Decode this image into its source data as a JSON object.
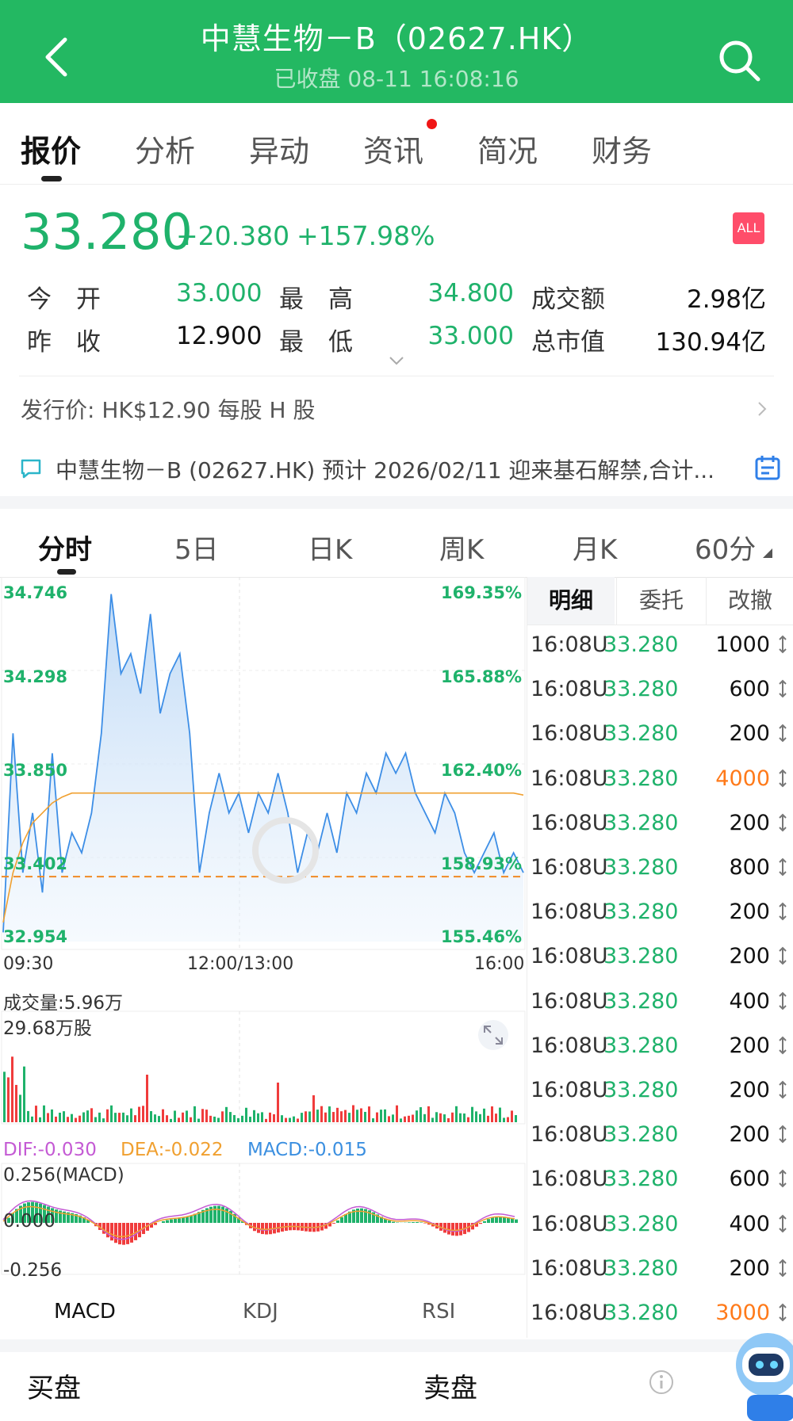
{
  "header": {
    "title": "中慧生物－B（02627.HK）",
    "status": "已收盘 08-11 16:08:16"
  },
  "tabs": [
    {
      "label": "报价",
      "active": true
    },
    {
      "label": "分析"
    },
    {
      "label": "异动"
    },
    {
      "label": "资讯",
      "badge": true
    },
    {
      "label": "简况"
    },
    {
      "label": "财务"
    }
  ],
  "quote": {
    "price": "33.280",
    "change": "+20.380",
    "change_pct": "+157.98%",
    "market_badge": "ALL",
    "open_label": "今　开",
    "open": "33.000",
    "high_label": "最　高",
    "high": "34.800",
    "turnover_label": "成交额",
    "turnover": "2.98亿",
    "prev_close_label": "昨　收",
    "prev_close": "12.900",
    "low_label": "最　低",
    "low": "33.000",
    "mktcap_label": "总市值",
    "mktcap": "130.94亿"
  },
  "issue_price": "发行价: HK$12.90 每股 H 股",
  "news_ticker": "中慧生物－B (02627.HK) 预计 2026/02/11 迎来基石解禁,合计...",
  "chart_tabs": [
    {
      "label": "分时",
      "active": true
    },
    {
      "label": "5日"
    },
    {
      "label": "日K"
    },
    {
      "label": "周K"
    },
    {
      "label": "月K"
    },
    {
      "label": "60分"
    }
  ],
  "chart_data": {
    "type": "line",
    "price_axis": [
      "34.746",
      "34.298",
      "33.850",
      "33.402",
      "32.954"
    ],
    "pct_axis": [
      "169.35%",
      "165.88%",
      "162.40%",
      "158.93%",
      "155.46%"
    ],
    "time_axis": [
      "09:30",
      "12:00/13:00",
      "16:00"
    ],
    "ylim": [
      32.954,
      34.746
    ],
    "ref_level": 33.28,
    "price": [
      33.0,
      34.0,
      33.3,
      33.6,
      33.2,
      33.9,
      33.3,
      33.5,
      33.4,
      33.6,
      34.0,
      34.7,
      34.3,
      34.4,
      34.2,
      34.6,
      34.1,
      34.3,
      34.4,
      34.0,
      33.3,
      33.6,
      33.8,
      33.6,
      33.7,
      33.5,
      33.7,
      33.6,
      33.8,
      33.6,
      33.3,
      33.5,
      33.4,
      33.6,
      33.4,
      33.7,
      33.6,
      33.8,
      33.7,
      33.9,
      33.8,
      33.9,
      33.7,
      33.6,
      33.5,
      33.7,
      33.6,
      33.4,
      33.3,
      33.4,
      33.5,
      33.3,
      33.4,
      33.3
    ],
    "avg": [
      33.05,
      33.3,
      33.45,
      33.55,
      33.6,
      33.65,
      33.68,
      33.7,
      33.7,
      33.7,
      33.7,
      33.7,
      33.7,
      33.7,
      33.7,
      33.7,
      33.7,
      33.7,
      33.7,
      33.7,
      33.7,
      33.7,
      33.7,
      33.7,
      33.7,
      33.7,
      33.7,
      33.7,
      33.7,
      33.7,
      33.7,
      33.7,
      33.7,
      33.7,
      33.7,
      33.7,
      33.7,
      33.7,
      33.7,
      33.7,
      33.7,
      33.7,
      33.7,
      33.7,
      33.7,
      33.7,
      33.7,
      33.7,
      33.7,
      33.7,
      33.7,
      33.7,
      33.7,
      33.69
    ],
    "volume_label": "成交量:5.96万",
    "volume_max_label": "29.68万股",
    "macd_dif": "DIF:-0.030",
    "macd_dea": "DEA:-0.022",
    "macd_val": "MACD:-0.015",
    "macd_top": "0.256(MACD)",
    "macd_zero": "0.000",
    "macd_bottom": "-0.256"
  },
  "detail_tabs": [
    {
      "label": "明细",
      "active": true
    },
    {
      "label": "委托"
    },
    {
      "label": "改撤"
    }
  ],
  "trades": [
    {
      "time": "16:08U",
      "price": "33.280",
      "vol": "1000"
    },
    {
      "time": "16:08U",
      "price": "33.280",
      "vol": "600"
    },
    {
      "time": "16:08U",
      "price": "33.280",
      "vol": "200"
    },
    {
      "time": "16:08U",
      "price": "33.280",
      "vol": "4000",
      "highlight": true
    },
    {
      "time": "16:08U",
      "price": "33.280",
      "vol": "200"
    },
    {
      "time": "16:08U",
      "price": "33.280",
      "vol": "800"
    },
    {
      "time": "16:08U",
      "price": "33.280",
      "vol": "200"
    },
    {
      "time": "16:08U",
      "price": "33.280",
      "vol": "200"
    },
    {
      "time": "16:08U",
      "price": "33.280",
      "vol": "400"
    },
    {
      "time": "16:08U",
      "price": "33.280",
      "vol": "200"
    },
    {
      "time": "16:08U",
      "price": "33.280",
      "vol": "200"
    },
    {
      "time": "16:08U",
      "price": "33.280",
      "vol": "200"
    },
    {
      "time": "16:08U",
      "price": "33.280",
      "vol": "600"
    },
    {
      "time": "16:08U",
      "price": "33.280",
      "vol": "400"
    },
    {
      "time": "16:08U",
      "price": "33.280",
      "vol": "200"
    },
    {
      "time": "16:08U",
      "price": "33.280",
      "vol": "3000",
      "highlight": true
    }
  ],
  "indicator_tabs": [
    {
      "label": "MACD",
      "active": true
    },
    {
      "label": "KDJ"
    },
    {
      "label": "RSI"
    }
  ],
  "bottom": {
    "buy": "买盘",
    "sell": "卖盘"
  },
  "colors": {
    "header_bg": "#23b862",
    "price_green": "#1fb26b",
    "highlight_orange": "#ff7a1a",
    "down_red": "#f03c3c",
    "dif_color": "#c45ad4",
    "dea_color": "#f0a030",
    "macd_color": "#3b8fe0"
  }
}
